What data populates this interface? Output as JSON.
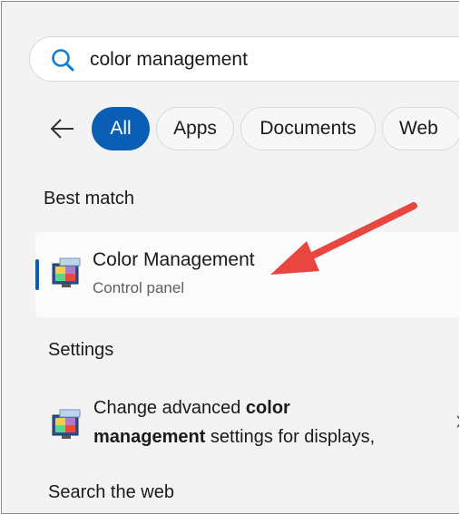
{
  "search": {
    "query": "color management"
  },
  "filters": {
    "chips": [
      {
        "label": "All",
        "active": true
      },
      {
        "label": "Apps",
        "active": false
      },
      {
        "label": "Documents",
        "active": false
      },
      {
        "label": "Web",
        "active": false
      }
    ]
  },
  "sections": {
    "best_match": "Best match",
    "settings": "Settings",
    "search_web": "Search the web"
  },
  "best_match_item": {
    "title": "Color Management",
    "subtitle": "Control panel",
    "icon": "color-management-icon"
  },
  "settings_item": {
    "line1_prefix": "Change advanced ",
    "line1_bold": "color",
    "line2_bold": "management",
    "line2_suffix": " settings for displays,",
    "icon": "color-management-icon"
  },
  "colors": {
    "accent": "#0a5fb5",
    "annotation_arrow": "#e8463f"
  }
}
